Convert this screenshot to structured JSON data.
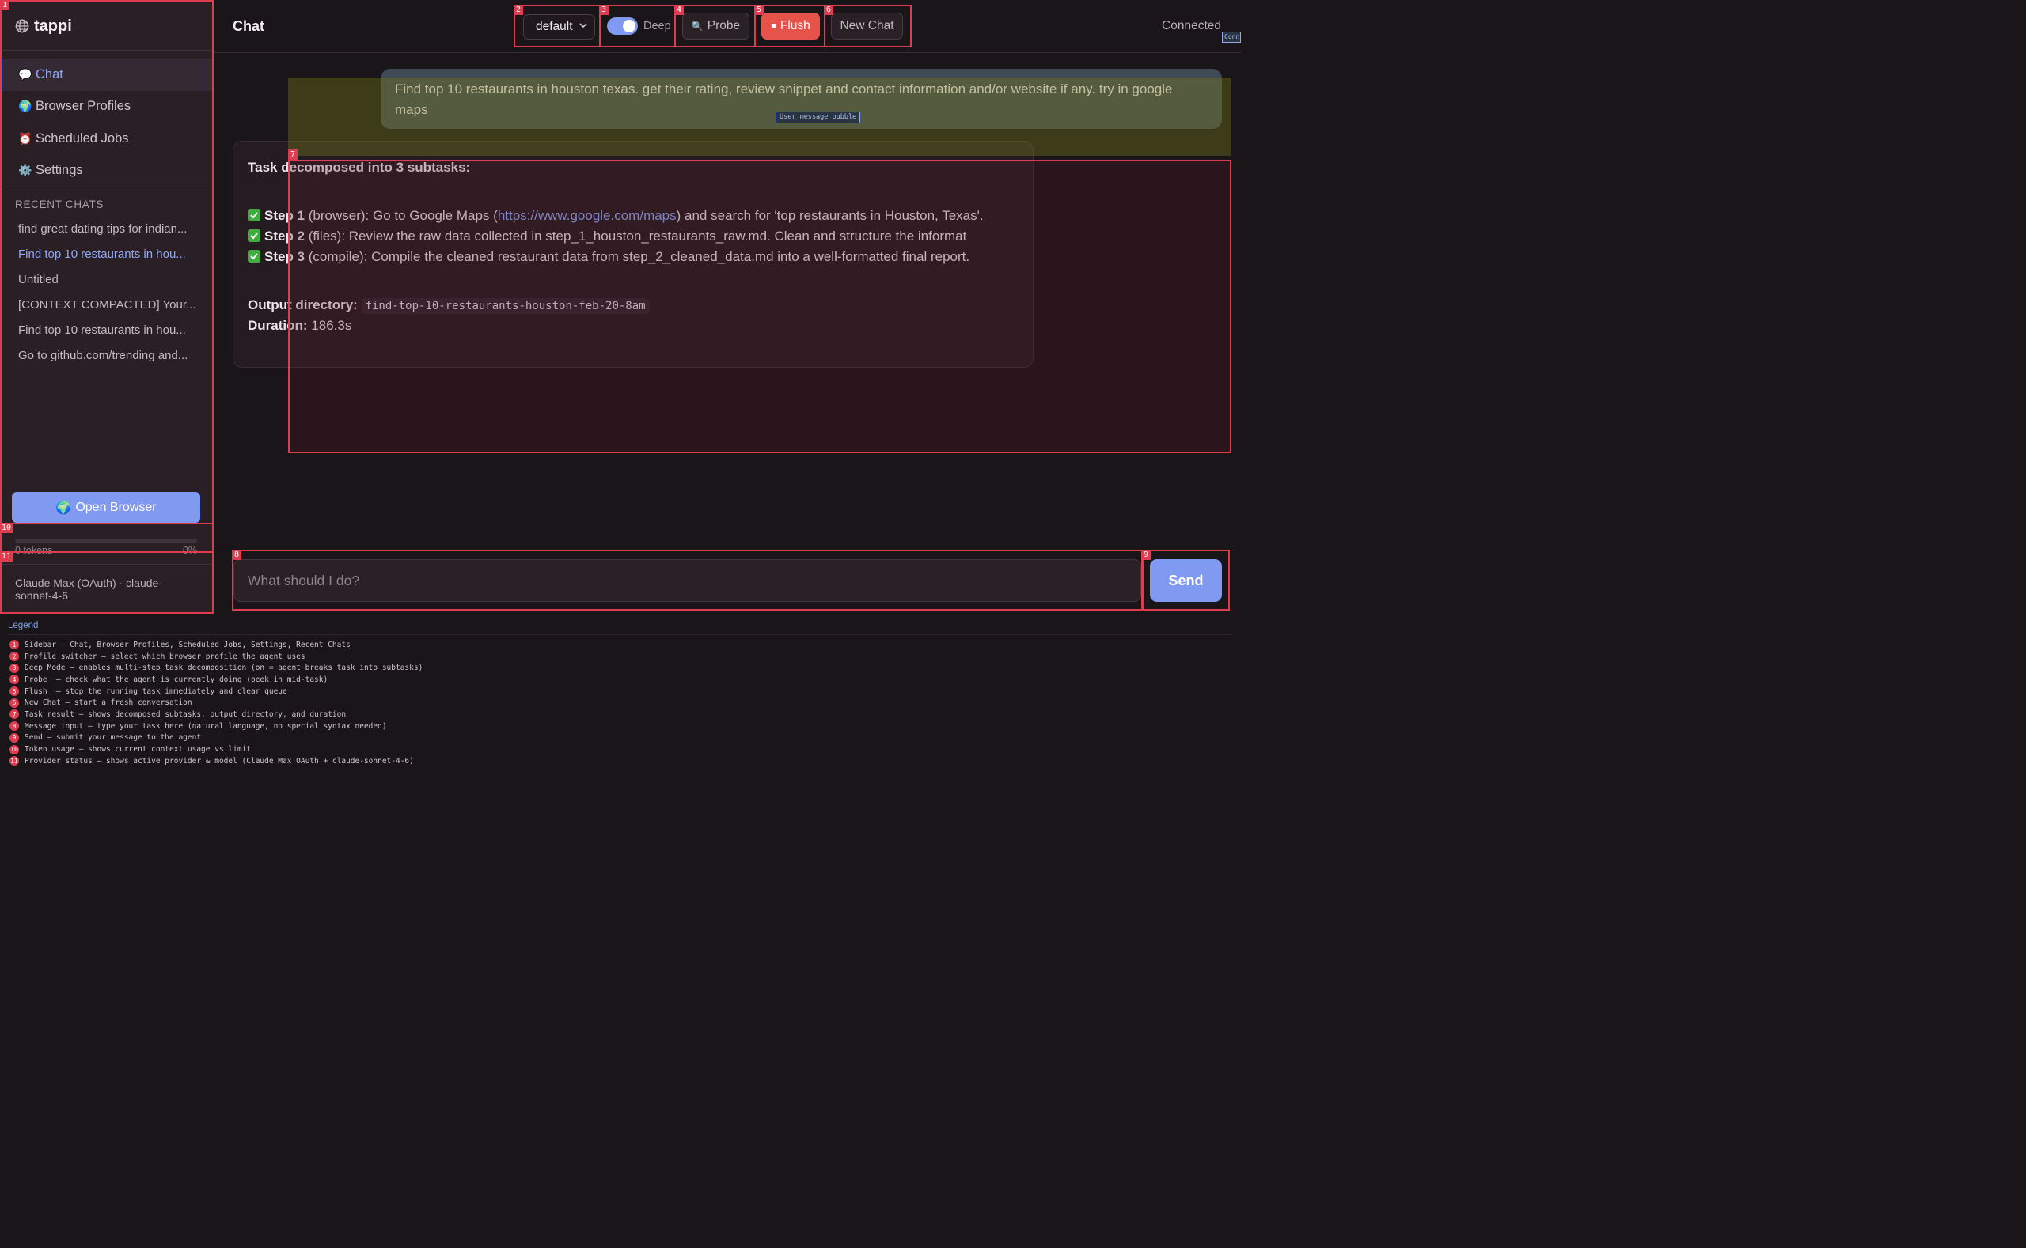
{
  "app": {
    "name": "tappi"
  },
  "sidebar": {
    "nav": [
      {
        "label": "Chat",
        "icon": "speech-bubble-icon",
        "glyph": "💬",
        "active": true
      },
      {
        "label": "Browser Profiles",
        "icon": "globe-icon",
        "glyph": "🌍",
        "active": false
      },
      {
        "label": "Scheduled Jobs",
        "icon": "alarm-clock-icon",
        "glyph": "⏰",
        "active": false
      },
      {
        "label": "Settings",
        "icon": "gear-icon",
        "glyph": "⚙️",
        "active": false
      }
    ],
    "recent_title": "RECENT CHATS",
    "recent_chats": [
      {
        "label": "find great dating tips for indian...",
        "active": false
      },
      {
        "label": "Find top 10 restaurants in hou...",
        "active": true
      },
      {
        "label": "Untitled",
        "active": false
      },
      {
        "label": "[CONTEXT COMPACTED] Your...",
        "active": false
      },
      {
        "label": "Find top 10 restaurants in hou...",
        "active": false
      },
      {
        "label": "Go to github.com/trending and...",
        "active": false
      }
    ],
    "open_browser_label": "Open Browser",
    "open_browser_glyph": "🌍",
    "tokens": {
      "label": "0 tokens",
      "percent_label": "0%",
      "fill_fraction": 0
    },
    "provider": "Claude Max (OAuth) · claude-sonnet-4-6"
  },
  "header": {
    "title": "Chat",
    "profile": {
      "selected": "default"
    },
    "deep_mode": {
      "label": "Deep",
      "enabled": true
    },
    "probe_label": "Probe",
    "probe_glyph": "🔍",
    "flush_label": "Flush",
    "flush_glyph": "■",
    "new_chat_label": "New Chat",
    "status": "Connected",
    "status_caption": "Conn"
  },
  "chat": {
    "user_message": "Find top 10 restaurants in houston texas. get their rating, review snippet and contact information and/or website if any. try in google maps",
    "user_caption": "User message bubble",
    "result": {
      "title": "Task decomposed into 3 subtasks:",
      "steps": [
        {
          "label": "Step 1",
          "kind": "(browser):",
          "text_before": " Go to Google Maps (",
          "link": "https://www.google.com/maps",
          "text_after": ") and search for 'top restaurants in Houston, Texas'."
        },
        {
          "label": "Step 2",
          "kind": "(files):",
          "text_before": " Review the raw data collected in step_1_houston_restaurants_raw.md. Clean and structure the informat",
          "link": "",
          "text_after": ""
        },
        {
          "label": "Step 3",
          "kind": "(compile):",
          "text_before": " Compile the cleaned restaurant data from step_2_cleaned_data.md into a well-formatted final report.",
          "link": "",
          "text_after": ""
        }
      ],
      "output_label": "Output directory:",
      "output_dir": "find-top-10-restaurants-houston-feb-20-8am",
      "duration_label": "Duration:",
      "duration": "186.3s"
    }
  },
  "composer": {
    "placeholder": "What should I do?",
    "send_label": "Send"
  },
  "annotations": [
    "1",
    "2",
    "3",
    "4",
    "5",
    "6",
    "7",
    "8",
    "9",
    "10",
    "11"
  ],
  "legend": {
    "title": "Legend",
    "items": [
      {
        "n": "1",
        "text": "Sidebar — Chat, Browser Profiles, Scheduled Jobs, Settings, Recent Chats"
      },
      {
        "n": "2",
        "text": "Profile switcher — select which browser profile the agent uses"
      },
      {
        "n": "3",
        "text": "Deep Mode — enables multi-step task decomposition (on = agent breaks task into subtasks)"
      },
      {
        "n": "4",
        "text": "Probe  — check what the agent is currently doing (peek in mid-task)"
      },
      {
        "n": "5",
        "text": "Flush  — stop the running task immediately and clear queue"
      },
      {
        "n": "6",
        "text": "New Chat — start a fresh conversation"
      },
      {
        "n": "7",
        "text": "Task result — shows decomposed subtasks, output directory, and duration"
      },
      {
        "n": "8",
        "text": "Message input — type your task here (natural language, no special syntax needed)"
      },
      {
        "n": "9",
        "text": "Send — submit your message to the agent"
      },
      {
        "n": "10",
        "text": "Token usage — shows current context usage vs limit"
      },
      {
        "n": "11",
        "text": "Provider status — shows active provider & model (Claude Max OAuth + claude-sonnet-4-6)"
      }
    ]
  },
  "colors": {
    "accent": "#7f9af0",
    "danger": "#e5534b",
    "annotation": "#e03c50",
    "success": "#3fae3f"
  }
}
